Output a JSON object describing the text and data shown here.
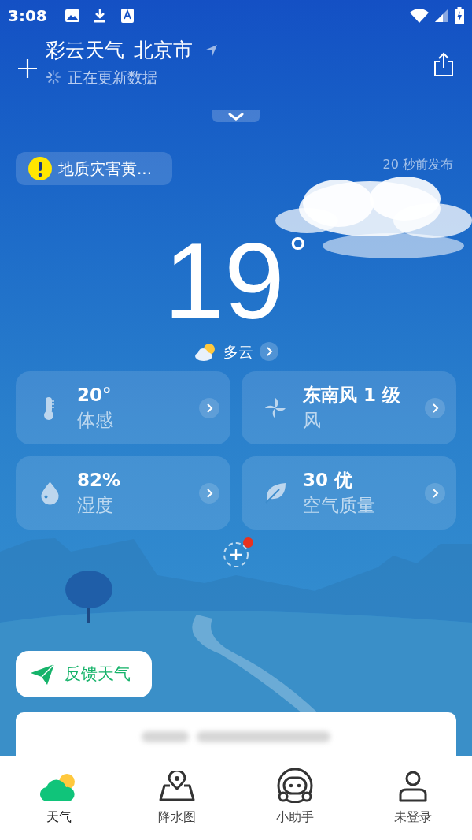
{
  "status_bar": {
    "time": "3:08"
  },
  "header": {
    "app_name": "彩云天气",
    "city": "北京市",
    "status": "正在更新数据"
  },
  "alert": {
    "text": "地质灾害黄...",
    "published": "20 秒前发布"
  },
  "current": {
    "temperature": "19",
    "unit": "°",
    "condition": "多云"
  },
  "cards": [
    {
      "kind": "feels",
      "value": "20°",
      "label": "体感"
    },
    {
      "kind": "wind",
      "value": "东南风 1 级",
      "label": "风"
    },
    {
      "kind": "humidity",
      "value": "82%",
      "label": "湿度"
    },
    {
      "kind": "air",
      "value": "30 优",
      "label": "空气质量"
    }
  ],
  "add_card": {
    "badge": true
  },
  "feedback_button": "反馈天气",
  "bottom_nav": [
    {
      "kind": "weather",
      "label": "天气",
      "selected": true
    },
    {
      "kind": "map",
      "label": "降水图",
      "selected": false
    },
    {
      "kind": "assistant",
      "label": "小助手",
      "selected": false
    },
    {
      "kind": "user",
      "label": "未登录",
      "selected": false
    }
  ]
}
